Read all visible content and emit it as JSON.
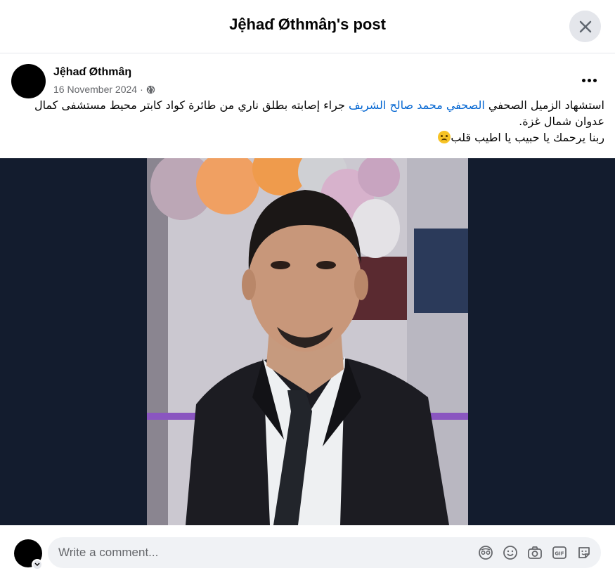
{
  "header": {
    "title": "Jệhaɗ Øthmâŋ's post",
    "close_icon": "close-icon"
  },
  "post": {
    "author": "Jệhaɗ Øthmâŋ",
    "date": "16 November 2024",
    "separator": "·",
    "privacy_icon": "globe-icon",
    "text_line1_start": "استشهاد الزميل الصحفي ",
    "mention": "الصحفي محمد صالح الشريف",
    "text_line1_end": "  جراء إصابته بطلق ناري من طائرة كواد كابتر محيط مستشفى كمال عدوان شمال غزة.",
    "text_line2": "ربنا يرحمك يا حبيب يا اطيب قلب",
    "emoji": "sad-face-emoji"
  },
  "comment": {
    "placeholder": "Write a comment...",
    "tools": [
      "avatar-sticker-icon",
      "emoji-icon",
      "camera-icon",
      "gif-icon",
      "sticker-icon"
    ]
  },
  "colors": {
    "link": "#0064d1",
    "photo_frame": "#131c2e",
    "muted": "#65676b"
  }
}
